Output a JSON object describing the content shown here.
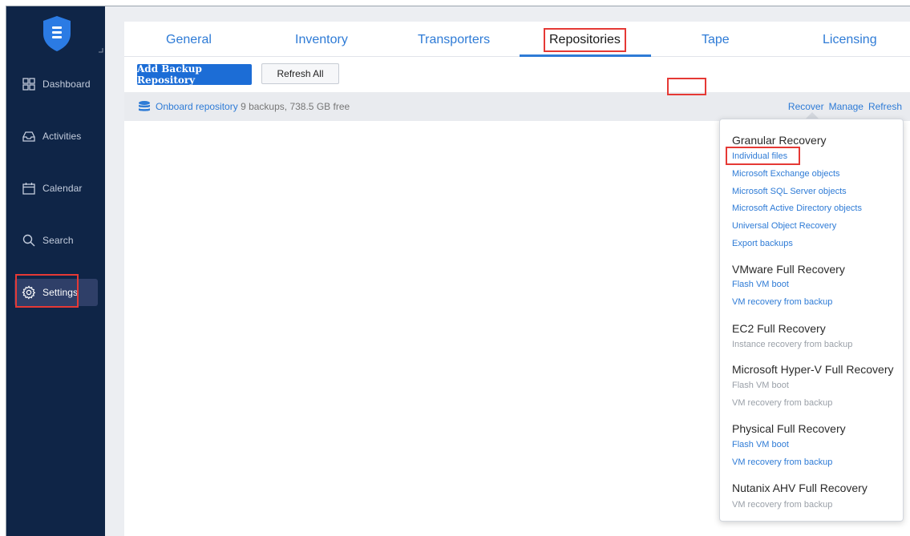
{
  "sidebar": {
    "items": [
      {
        "label": "Dashboard",
        "icon": "dashboard-icon"
      },
      {
        "label": "Activities",
        "icon": "inbox-icon"
      },
      {
        "label": "Calendar",
        "icon": "calendar-icon"
      },
      {
        "label": "Search",
        "icon": "search-icon"
      },
      {
        "label": "Settings",
        "icon": "gear-icon",
        "active": true
      }
    ]
  },
  "tabs": [
    {
      "label": "General"
    },
    {
      "label": "Inventory"
    },
    {
      "label": "Transporters"
    },
    {
      "label": "Repositories",
      "active": true
    },
    {
      "label": "Tape"
    },
    {
      "label": "Licensing"
    }
  ],
  "toolbar": {
    "add_label": "Add Backup Repository",
    "refresh_all_label": "Refresh All"
  },
  "repository": {
    "name": "Onboard repository",
    "meta": "9 backups, 738.5 GB free",
    "actions": {
      "recover": "Recover",
      "manage": "Manage",
      "refresh": "Refresh"
    }
  },
  "recover_menu": {
    "sections": [
      {
        "title": "Granular Recovery",
        "items": [
          {
            "label": "Individual files",
            "enabled": true
          },
          {
            "label": "Microsoft Exchange objects",
            "enabled": true
          },
          {
            "label": "Microsoft SQL Server objects",
            "enabled": true
          },
          {
            "label": "Microsoft Active Directory objects",
            "enabled": true
          },
          {
            "label": "Universal Object Recovery",
            "enabled": true
          },
          {
            "label": "Export backups",
            "enabled": true
          }
        ]
      },
      {
        "title": "VMware Full Recovery",
        "items": [
          {
            "label": "Flash VM boot",
            "enabled": true
          },
          {
            "label": "VM recovery from backup",
            "enabled": true
          }
        ]
      },
      {
        "title": "EC2 Full Recovery",
        "items": [
          {
            "label": "Instance recovery from backup",
            "enabled": false
          }
        ]
      },
      {
        "title": "Microsoft Hyper-V Full Recovery",
        "items": [
          {
            "label": "Flash VM boot",
            "enabled": false
          },
          {
            "label": "VM recovery from backup",
            "enabled": false
          }
        ]
      },
      {
        "title": "Physical Full Recovery",
        "items": [
          {
            "label": "Flash VM boot",
            "enabled": true
          },
          {
            "label": "VM recovery from backup",
            "enabled": true
          }
        ]
      },
      {
        "title": "Nutanix AHV Full Recovery",
        "items": [
          {
            "label": "VM recovery from backup",
            "enabled": false
          }
        ]
      }
    ]
  },
  "colors": {
    "sidebar_bg": "#0f2547",
    "accent": "#2e7bd6",
    "primary_button": "#1c6dd6",
    "highlight_box": "#e53935",
    "disabled_text": "#9aa0a8"
  }
}
